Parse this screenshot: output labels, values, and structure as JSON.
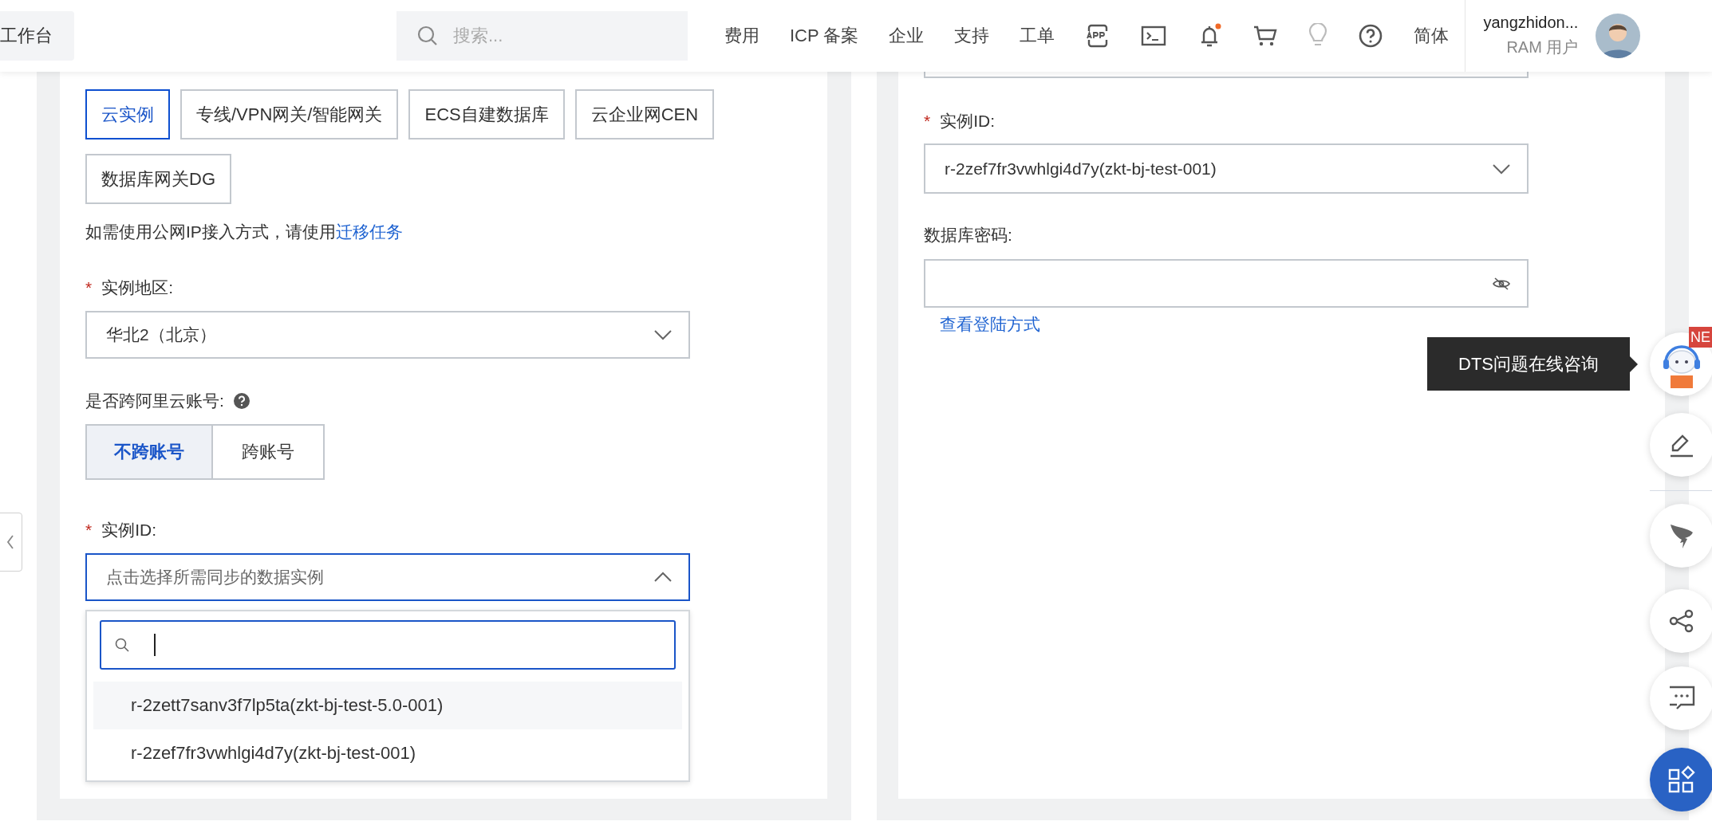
{
  "top_bar": {
    "workbench": "工作台",
    "search": {
      "placeholder": "搜索..."
    },
    "nav_links": [
      "费用",
      "ICP 备案",
      "企业",
      "支持",
      "工单"
    ],
    "notifications": {
      "unread": true
    },
    "language": "简体",
    "user": {
      "name": "yangzhidon...",
      "role": "RAM 用户"
    }
  },
  "source_form": {
    "access_types": [
      {
        "label": "云实例",
        "selected": true
      },
      {
        "label": "专线/VPN网关/智能网关",
        "selected": false
      },
      {
        "label": "ECS自建数据库",
        "selected": false
      },
      {
        "label": "云企业网CEN",
        "selected": false
      },
      {
        "label": "数据库网关DG",
        "selected": false
      }
    ],
    "hint": {
      "text": "如需使用公网IP接入方式，请使用",
      "link": "迁移任务"
    },
    "region": {
      "label": "实例地区:",
      "required_mark": "*",
      "value": "华北2（北京）"
    },
    "cross_account": {
      "label": "是否跨阿里云账号:",
      "help": true,
      "options": [
        {
          "label": "不跨账号",
          "selected": true
        },
        {
          "label": "跨账号",
          "selected": false
        }
      ]
    },
    "instance": {
      "label": "实例ID:",
      "required_mark": "*",
      "placeholder": "点击选择所需同步的数据实例",
      "expanded": true,
      "options": [
        {
          "label": "r-2zett7sanv3f7lp5ta(zkt-bj-test-5.0-001)",
          "highlighted": true
        },
        {
          "label": "r-2zef7fr3vwhlgi4d7y(zkt-bj-test-001)",
          "highlighted": false
        }
      ]
    }
  },
  "target_form": {
    "instance": {
      "label": "实例ID:",
      "required_mark": "*",
      "value": "r-2zef7fr3vwhlgi4d7y(zkt-bj-test-001)"
    },
    "password": {
      "label": "数据库密码:"
    },
    "login_link": "查看登陆方式"
  },
  "assistant": {
    "tooltip": "DTS问题在线咨询",
    "badge": "NE"
  }
}
